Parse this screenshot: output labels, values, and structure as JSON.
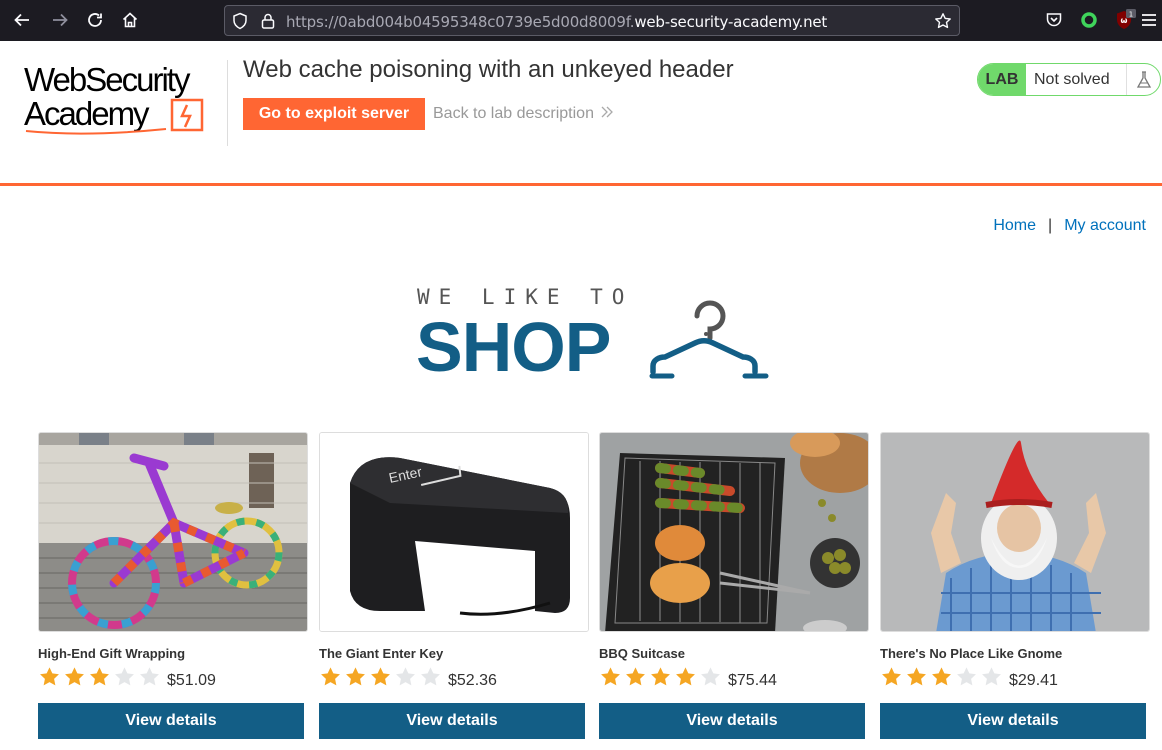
{
  "browser": {
    "url_dim": "https://0abd004b04595348c0739e5d00d8009f.",
    "url_host": "web-security-academy.net",
    "badge_count": "1"
  },
  "lab": {
    "title": "Web cache poisoning with an unkeyed header",
    "exploit_button": "Go to exploit server",
    "back_link": "Back to lab description",
    "badge": "LAB",
    "status": "Not solved",
    "logo_line1": "WebSecurity",
    "logo_line2": "Academy"
  },
  "nav": {
    "home": "Home",
    "separator": "|",
    "account": "My account"
  },
  "shop_logo": {
    "small": "WE LIKE TO",
    "big": "SHOP"
  },
  "products": [
    {
      "name": "High-End Gift Wrapping",
      "rating": 3,
      "price": "$51.09",
      "button": "View details"
    },
    {
      "name": "The Giant Enter Key",
      "rating": 3,
      "price": "$52.36",
      "button": "View details"
    },
    {
      "name": "BBQ Suitcase",
      "rating": 4,
      "price": "$75.44",
      "button": "View details"
    },
    {
      "name": "There's No Place Like Gnome",
      "rating": 3,
      "price": "$29.41",
      "button": "View details"
    }
  ],
  "colors": {
    "accent": "#ff6633",
    "brand_blue": "#135e86",
    "link_blue": "#0071bc",
    "lab_green": "#70d96b",
    "star_gold": "#f5a623"
  }
}
